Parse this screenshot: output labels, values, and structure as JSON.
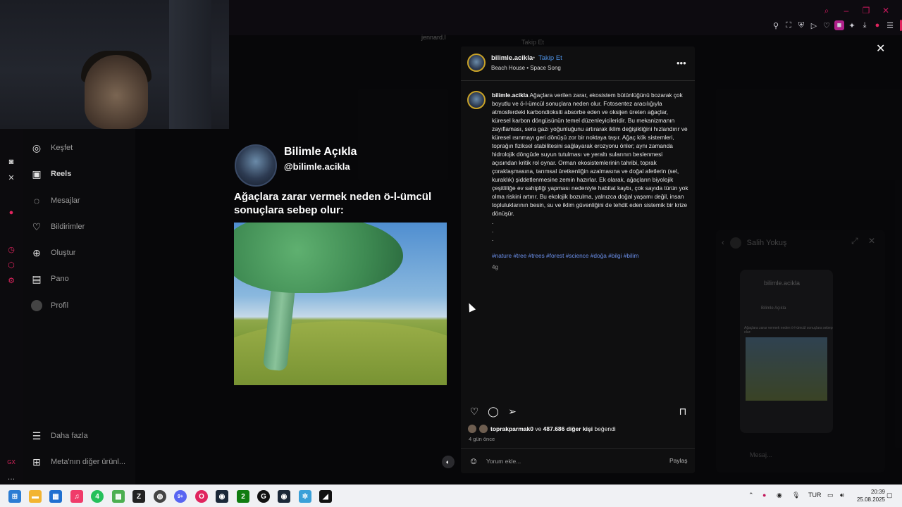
{
  "background": {
    "user": "jennard.l",
    "follow": "Takip Et"
  },
  "nav": {
    "items": [
      {
        "icon": "explore-icon",
        "label": "Keşfet"
      },
      {
        "icon": "reels-icon",
        "label": "Reels"
      },
      {
        "icon": "messages-icon",
        "label": "Mesajlar"
      },
      {
        "icon": "heart-icon",
        "label": "Bildirimler"
      },
      {
        "icon": "plus-icon",
        "label": "Oluştur"
      },
      {
        "icon": "dashboard-icon",
        "label": "Pano"
      },
      {
        "icon": "avatar",
        "label": "Profil"
      }
    ],
    "more": "Daha fazla",
    "meta": "Meta'nın diğer ürünl..."
  },
  "reel": {
    "name": "Bilimle Açıkla",
    "handle": "@bilimle.acikla",
    "title": "Ağaçlara zarar vermek neden ö-l-ümcül sonuçlara sebep olur:"
  },
  "post": {
    "username": "bilimle.acikla",
    "dot": "•",
    "follow": "Takip Et",
    "song": "Beach House • Space Song",
    "caption_user": "bilimle.acikla",
    "caption": " Ağaçlara verilen zarar, ekosistem bütünlüğünü bozarak çok boyutlu ve ö-l-ümcül sonuçlara neden olur. Fotosentez aracılığıyla atmosferdeki karbondioksiti absorbe eden ve oksijen üreten ağaçlar, küresel karbon döngüsünün temel düzenleyicileridir. Bu mekanizmanın zayıflaması, sera gazı yoğunluğunu artırarak iklim değişikliğini hızlandırır ve küresel ısınmayı geri dönüşü zor bir noktaya taşır. Ağaç kök sistemleri, toprağın fiziksel stabilitesini sağlayarak erozyonu önler; aynı zamanda hidrolojik döngüde suyun tutulması ve yeraltı sularının beslenmesi açısından kritik rol oynar. Orman ekosistemlerinin tahribi, toprak çoraklaşmasına, tarımsal üretkenliğin azalmasına ve doğal afetlerin (sel, kuraklık) şiddetlenmesine zemin hazırlar. Ek olarak, ağaçların biyolojik çeşitliliğe ev sahipliği yapması nedeniyle habitat kaybı, çok sayıda türün yok olma riskini artırır. Bu ekolojik bozulma, yalnızca doğal yaşamı değil, insan topluluklarının besin, su ve iklim güvenliğini de tehdit eden sistemik bir krize dönüşür.\n.\n.\n.",
    "hashtags": "#nature #tree #trees #forest #science #doğa #bilgi #bilim",
    "caption_time": "4g",
    "likes_user": "toprakparmak0",
    "likes_rest": " ve ",
    "likes_count": "487.686 diğer kişi",
    "likes_suffix": " beğendi",
    "time": "4 gün önce",
    "comment_placeholder": "Yorum ekle...",
    "share": "Paylaş"
  },
  "chat": {
    "name": "Salih Yokuş",
    "card_user": "bilimle.acikla",
    "card_name": "Bilimle Açıkla",
    "card_title": "Ağaçlara zarar vermek neden ö-l-ümcül sonuçlara sebep olur:",
    "message_placeholder": "Mesaj..."
  },
  "taskbar": {
    "lang": "TUR",
    "time": "20:39",
    "date": "25.08.2025",
    "badge_whatsapp": "4",
    "badge_discord": "9+",
    "badge_xbox": "2"
  }
}
